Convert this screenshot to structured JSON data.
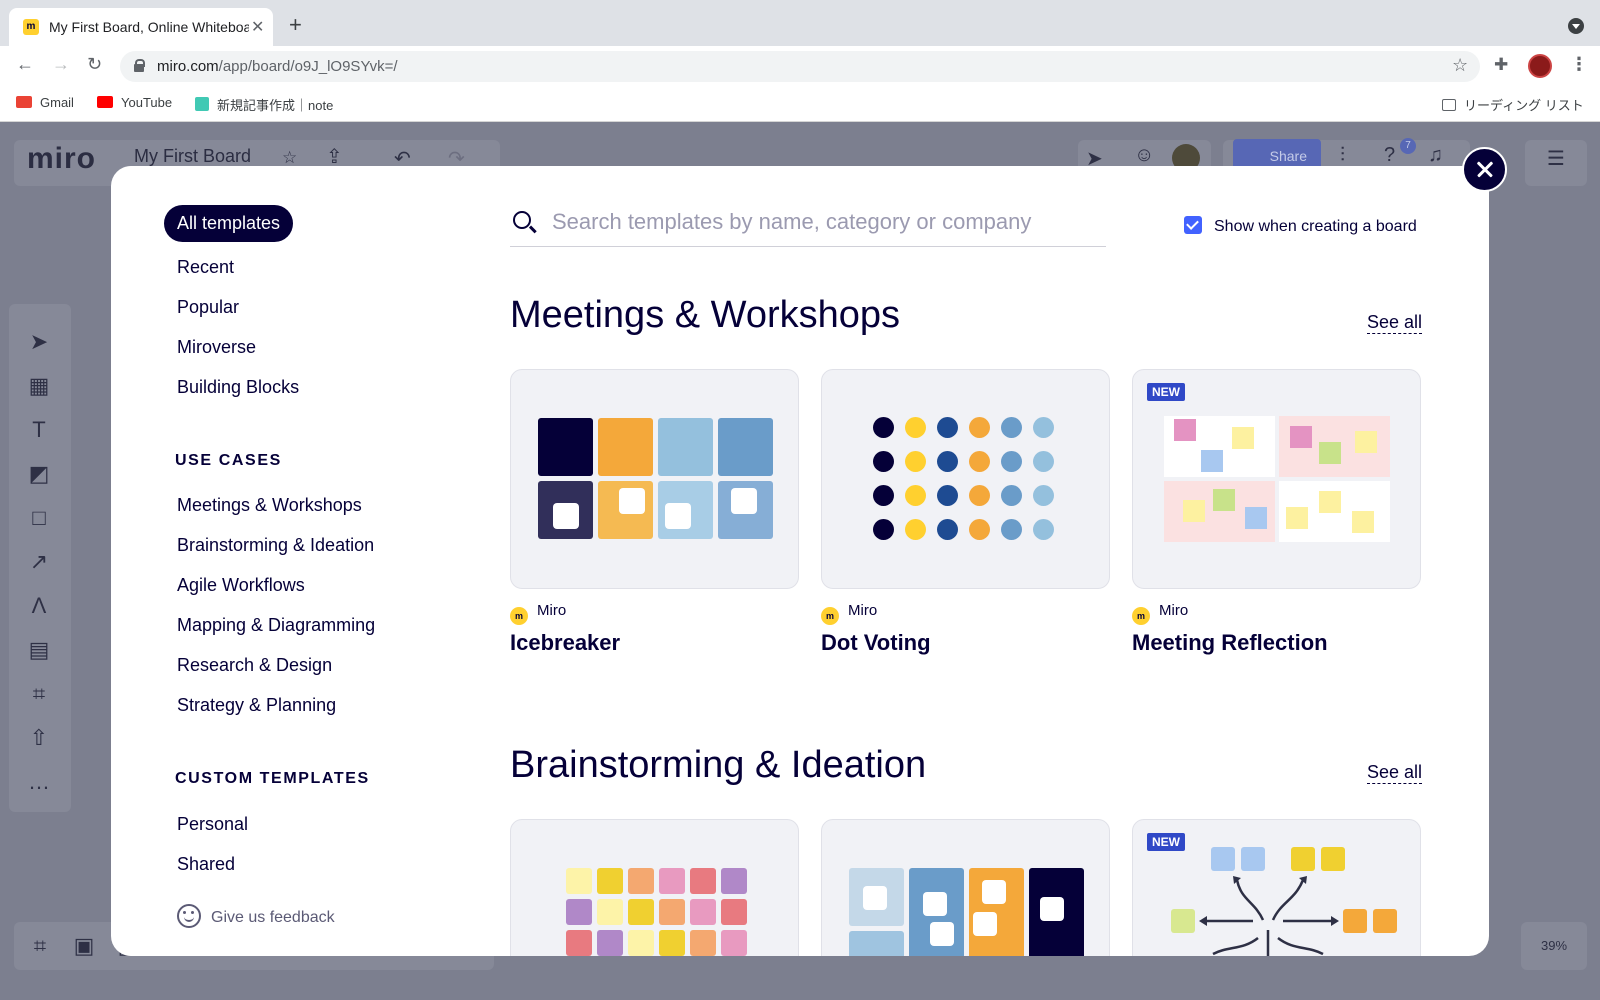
{
  "browser": {
    "tab_title": "My First Board, Online Whiteboard",
    "url_host": "miro.com",
    "url_path": "/app/board/o9J_lO9SYvk=/",
    "bookmarks": [
      {
        "label": "Gmail"
      },
      {
        "label": "YouTube"
      },
      {
        "label": "新規記事作成｜note"
      }
    ],
    "reading_list": "リーディング リスト"
  },
  "app": {
    "logo": "miro",
    "board_title": "My First Board",
    "share_label": "Share",
    "help_badge": "7",
    "zoom": "39%"
  },
  "modal": {
    "nav": {
      "active": "All templates",
      "items": [
        "Recent",
        "Popular",
        "Miroverse",
        "Building Blocks"
      ],
      "use_cases_heading": "USE CASES",
      "use_cases": [
        "Meetings & Workshops",
        "Brainstorming & Ideation",
        "Agile Workflows",
        "Mapping & Diagramming",
        "Research & Design",
        "Strategy & Planning"
      ],
      "custom_heading": "CUSTOM TEMPLATES",
      "custom": [
        "Personal",
        "Shared"
      ],
      "feedback": "Give us feedback"
    },
    "search": {
      "placeholder": "Search templates by name, category or company"
    },
    "show_when_creating": {
      "label": "Show when creating a board",
      "checked": true
    },
    "sections": [
      {
        "title": "Meetings & Workshops",
        "see_all": "See all",
        "cards": [
          {
            "author": "Miro",
            "title": "Icebreaker",
            "badge": ""
          },
          {
            "author": "Miro",
            "title": "Dot Voting",
            "badge": ""
          },
          {
            "author": "Miro",
            "title": "Meeting Reflection",
            "badge": "NEW"
          }
        ]
      },
      {
        "title": "Brainstorming & Ideation",
        "see_all": "See all",
        "cards": [
          {
            "badge": ""
          },
          {
            "badge": ""
          },
          {
            "badge": "NEW"
          }
        ]
      }
    ]
  },
  "colors": {
    "navy": "#050038",
    "accent_blue": "#4262ff",
    "badge_blue": "#3049c7",
    "miro_yellow": "#ffd02f"
  }
}
